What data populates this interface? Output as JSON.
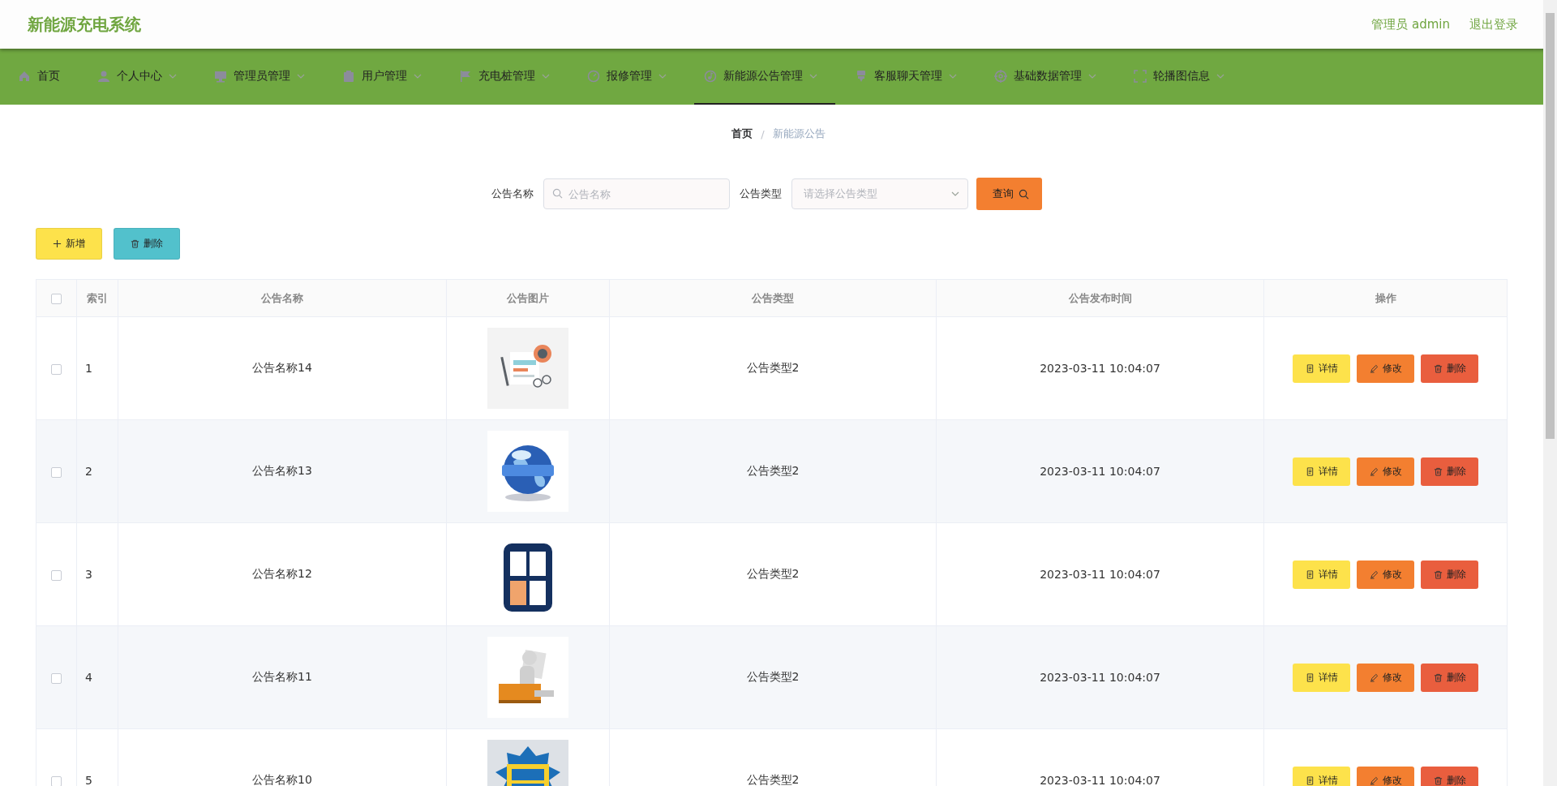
{
  "header": {
    "title": "新能源充电系统",
    "user": "管理员 admin",
    "logout": "退出登录"
  },
  "nav": [
    {
      "label": "首页",
      "selected": false,
      "dropdown": false
    },
    {
      "label": "个人中心",
      "selected": false,
      "dropdown": true
    },
    {
      "label": "管理员管理",
      "selected": false,
      "dropdown": true
    },
    {
      "label": "用户管理",
      "selected": false,
      "dropdown": true
    },
    {
      "label": "充电桩管理",
      "selected": false,
      "dropdown": true
    },
    {
      "label": "报修管理",
      "selected": false,
      "dropdown": true
    },
    {
      "label": "新能源公告管理",
      "selected": true,
      "dropdown": true
    },
    {
      "label": "客服聊天管理",
      "selected": false,
      "dropdown": true
    },
    {
      "label": "基础数据管理",
      "selected": false,
      "dropdown": true
    },
    {
      "label": "轮播图信息",
      "selected": false,
      "dropdown": true
    }
  ],
  "breadcrumb": [
    "首页",
    "新能源公告"
  ],
  "breadcrumb_separator": "/",
  "search": {
    "name_label": "公告名称",
    "name_placeholder": "公告名称",
    "type_label": "公告类型",
    "type_placeholder": "请选择公告类型",
    "query_button": "查询"
  },
  "actions": {
    "add": "新增",
    "delete": "删除"
  },
  "table": {
    "columns": [
      "索引",
      "公告名称",
      "公告图片",
      "公告类型",
      "公告发布时间",
      "操作"
    ],
    "header_checked": false,
    "rows": [
      {
        "checked": false,
        "index": "1",
        "name": "公告名称14",
        "type": "公告类型2",
        "time": "2023-03-11 10:04:07",
        "actions": [
          "详情",
          "修改",
          "删除"
        ]
      },
      {
        "checked": false,
        "index": "2",
        "name": "公告名称13",
        "type": "公告类型2",
        "time": "2023-03-11 10:04:07",
        "actions": [
          "详情",
          "修改",
          "删除"
        ]
      },
      {
        "checked": false,
        "index": "3",
        "name": "公告名称12",
        "type": "公告类型2",
        "time": "2023-03-11 10:04:07",
        "actions": [
          "详情",
          "修改",
          "删除"
        ]
      },
      {
        "checked": false,
        "index": "4",
        "name": "公告名称11",
        "type": "公告类型2",
        "time": "2023-03-11 10:04:07",
        "actions": [
          "详情",
          "修改",
          "删除"
        ]
      },
      {
        "checked": false,
        "index": "5",
        "name": "公告名称10",
        "type": "公告类型2",
        "time": "2023-03-11 10:04:07",
        "actions": [
          "详情",
          "修改",
          "删除"
        ]
      }
    ]
  }
}
